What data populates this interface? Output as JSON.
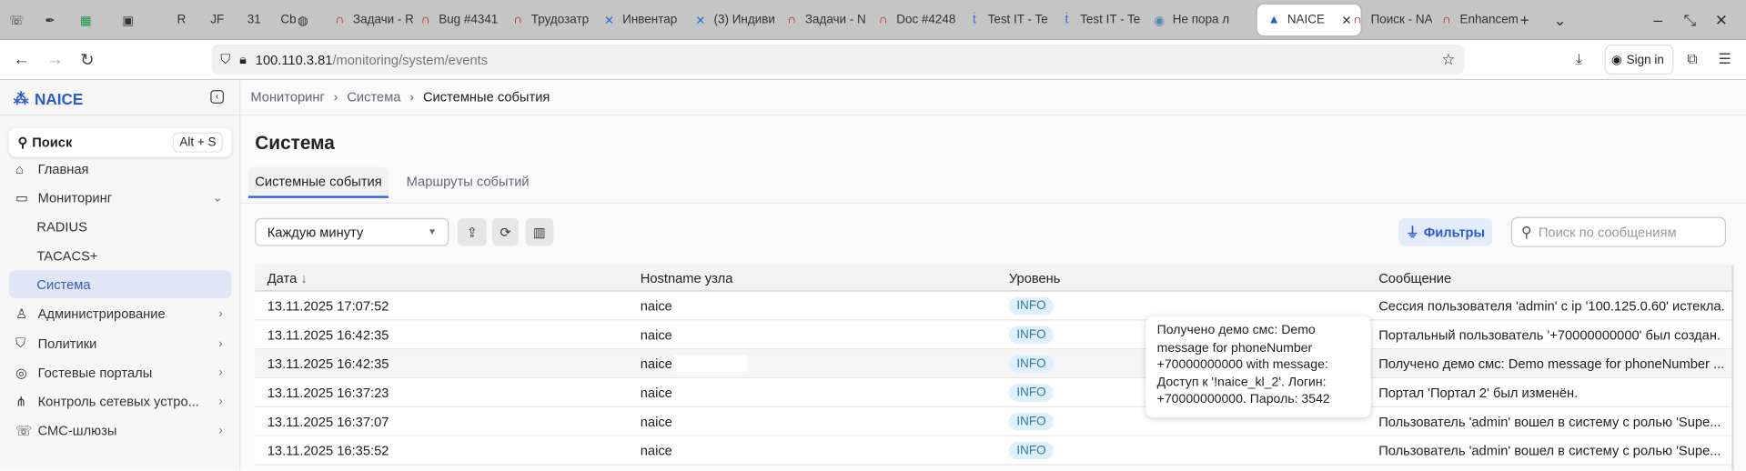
{
  "browser": {
    "tabs": [
      {
        "label": "",
        "icon": "phone-icon"
      },
      {
        "label": "",
        "icon": "feather-icon"
      },
      {
        "label": "",
        "icon": "sheets-icon"
      },
      {
        "label": "",
        "icon": "phpipam-icon"
      },
      {
        "label": "R",
        "icon": "r-icon"
      },
      {
        "label": "JF",
        "icon": "jf-icon"
      },
      {
        "label": "31",
        "icon": "calendar-icon"
      },
      {
        "label": "Cb",
        "icon": "cb-icon"
      },
      {
        "label": "",
        "icon": "globe-icon"
      },
      {
        "label": "Задачи - R",
        "icon": "redmine-icon"
      },
      {
        "label": "Bug #4341",
        "icon": "redmine-icon"
      },
      {
        "label": "Трудозатр",
        "icon": "redmine-icon"
      },
      {
        "label": "Инвентар",
        "icon": "confluence-icon"
      },
      {
        "label": "(3) Индиви",
        "icon": "confluence-icon"
      },
      {
        "label": "Задачи - N",
        "icon": "redmine-icon"
      },
      {
        "label": "Doc #4248",
        "icon": "redmine-icon"
      },
      {
        "label": "Test IT - Te",
        "icon": "testit-icon"
      },
      {
        "label": "Test IT - Te",
        "icon": "testit-icon"
      },
      {
        "label": "Не пора л",
        "icon": "app-icon"
      },
      {
        "label": "NAICE",
        "icon": "naice-icon",
        "active": true
      },
      {
        "label": "Поиск - NA",
        "icon": "redmine-icon"
      },
      {
        "label": "Enhancem",
        "icon": "redmine-icon"
      }
    ],
    "url_host": "100.110.3.81",
    "url_path": "/monitoring/system/events",
    "sign_in": "Sign in"
  },
  "sidebar": {
    "brand": "NAICE",
    "search_label": "Поиск",
    "search_shortcut": "Alt + S",
    "items": [
      {
        "label": "Главная",
        "icon": "home-icon"
      },
      {
        "label": "Мониторинг",
        "icon": "monitor-icon",
        "expanded": true
      },
      {
        "label": "RADIUS",
        "sub": true
      },
      {
        "label": "TACACS+",
        "sub": true
      },
      {
        "label": "Система",
        "sub": true,
        "selected": true
      },
      {
        "label": "Администрирование",
        "icon": "user-icon",
        "chevron": true
      },
      {
        "label": "Политики",
        "icon": "shield-icon",
        "chevron": true
      },
      {
        "label": "Гостевые порталы",
        "icon": "wifi-icon",
        "chevron": true
      },
      {
        "label": "Контроль сетевых устро...",
        "icon": "network-icon",
        "chevron": true
      },
      {
        "label": "СМС-шлюзы",
        "icon": "phone-icon",
        "chevron": true
      }
    ]
  },
  "main": {
    "breadcrumb": [
      "Мониторинг",
      "Система",
      "Системные события"
    ],
    "title": "Система",
    "tabs": [
      {
        "label": "Системные события",
        "active": true
      },
      {
        "label": "Маршруты событий"
      }
    ],
    "refresh_select": "Каждую минуту",
    "filters_label": "Фильтры",
    "search_placeholder": "Поиск по сообщениям",
    "columns": [
      "Дата",
      "Hostname узла",
      "Уровень",
      "Сообщение"
    ],
    "rows": [
      {
        "date": "13.11.2025 17:07:52",
        "host": "naice",
        "level": "INFO",
        "message": "Сессия пользователя 'admin' с ip '100.125.0.60' истекла."
      },
      {
        "date": "13.11.2025 16:42:35",
        "host": "naice",
        "level": "INFO",
        "message": "Портальный пользователь '+70000000000' был создан."
      },
      {
        "date": "13.11.2025 16:42:35",
        "host": "naice",
        "level": "INFO",
        "message": "Получено демо смс: Demo message for phoneNumber ..."
      },
      {
        "date": "13.11.2025 16:37:23",
        "host": "naice",
        "level": "INFO",
        "message": "Портал 'Портал 2' был изменён."
      },
      {
        "date": "13.11.2025 16:37:07",
        "host": "naice",
        "level": "INFO",
        "message": "Пользователь 'admin' вошел в систему с ролью 'Supe..."
      },
      {
        "date": "13.11.2025 16:35:52",
        "host": "naice",
        "level": "INFO",
        "message": "Пользователь 'admin' вошел в систему с ролью 'Supe..."
      }
    ],
    "tooltip": "Получено демо смс: Demo message for phoneNumber +70000000000 with message: Доступ к '!naice_kl_2'. Логин: +70000000000. Пароль: 3542"
  },
  "colors": {
    "accent": "#2a5bd7",
    "info_bg": "#e0f0fb",
    "info_text": "#2a7ab0",
    "selected_bg": "#dfe6f5"
  }
}
